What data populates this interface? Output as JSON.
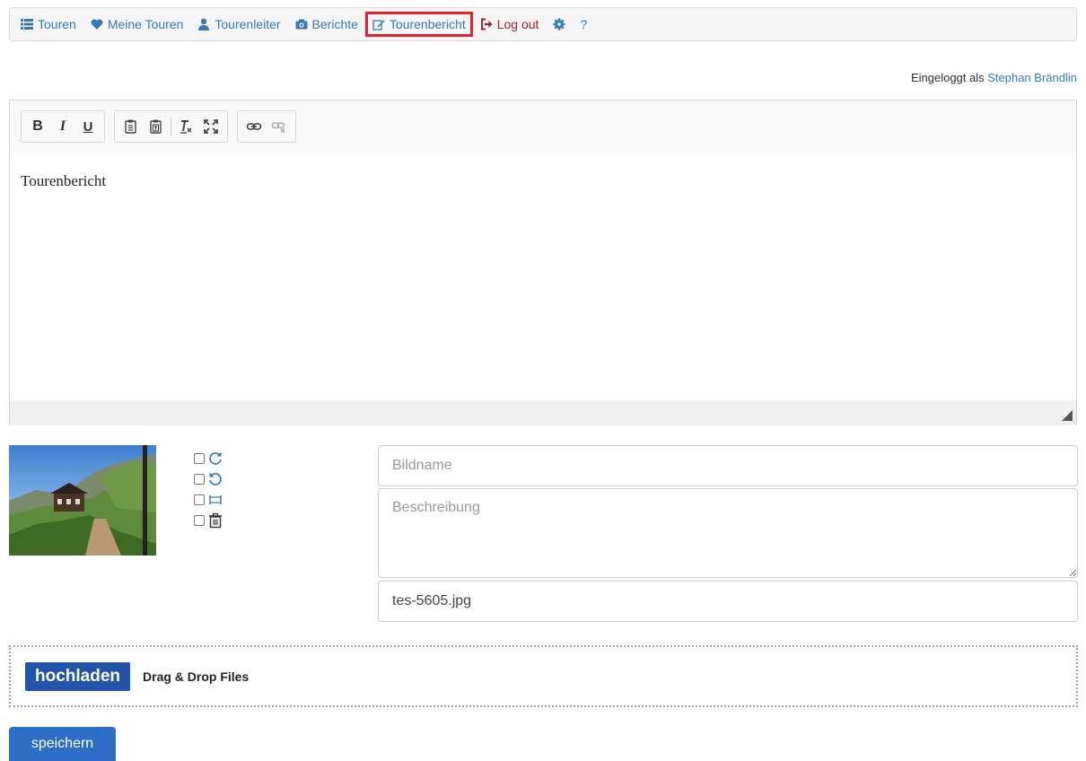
{
  "nav": {
    "items": [
      {
        "label": "Touren",
        "icon": "list-icon"
      },
      {
        "label": "Meine Touren",
        "icon": "heart-icon"
      },
      {
        "label": "Tourenleiter",
        "icon": "user-icon"
      },
      {
        "label": "Berichte",
        "icon": "camera-icon"
      },
      {
        "label": "Tourenbericht",
        "icon": "edit-icon"
      },
      {
        "label": "Log out",
        "icon": "logout-icon"
      },
      {
        "label": "",
        "icon": "gear-icon"
      },
      {
        "label": "?",
        "icon": "help"
      }
    ],
    "colors": {
      "link": "#337ab7",
      "logout": "#a01f2d",
      "highlight": "#e8202a"
    }
  },
  "login": {
    "prefix": "Eingeloggt als",
    "user": "Stephan Brändlin"
  },
  "editor": {
    "toolbar": [
      "bold-icon",
      "italic-icon",
      "underline-icon",
      "paste-icon",
      "paste-text-icon",
      "remove-format-icon",
      "maximize-icon",
      "link-icon",
      "unlink-icon"
    ],
    "bold_label": "B",
    "italic_label": "I",
    "underline_label": "U",
    "content": "Tourenbericht"
  },
  "image": {
    "actions": [
      "rotate-right-icon",
      "rotate-left-icon",
      "resize-icon",
      "trash-icon"
    ],
    "name_placeholder": "Bildname",
    "description_placeholder": "Beschreibung",
    "filename": "tes-5605.jpg"
  },
  "upload": {
    "button_label": "hochladen",
    "drop_label": "Drag & Drop Files",
    "color": "#2255aa"
  },
  "save": {
    "label": "speichern",
    "color": "#2d6fc7"
  }
}
